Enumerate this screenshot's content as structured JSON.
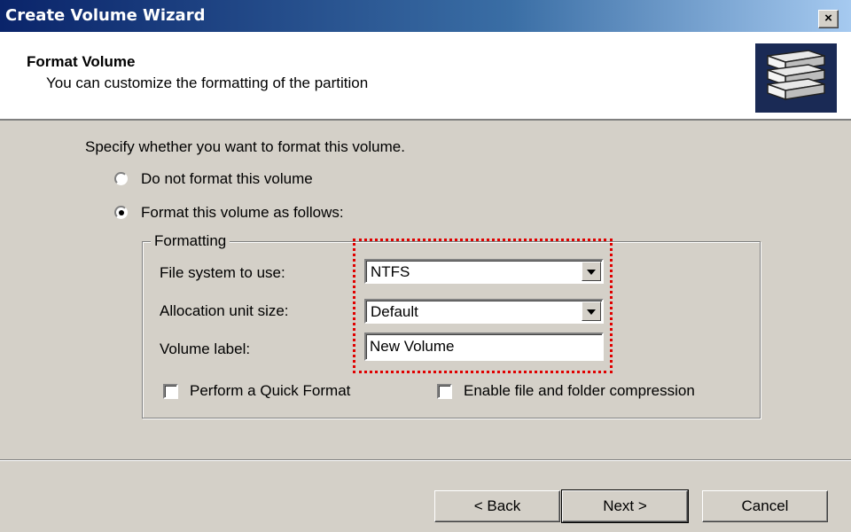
{
  "window": {
    "title": "Create Volume Wizard",
    "close_label": "×"
  },
  "header": {
    "title": "Format Volume",
    "subtitle": "You can customize the formatting of the partition"
  },
  "prompt": "Specify whether you want to format this volume.",
  "options": {
    "no_format": "Do not format this volume",
    "format": "Format this volume as follows:",
    "selected": "format"
  },
  "formatting": {
    "legend": "Formatting",
    "file_system_label": "File system to use:",
    "file_system_value": "NTFS",
    "allocation_label": "Allocation unit size:",
    "allocation_value": "Default",
    "volume_label_label": "Volume label:",
    "volume_label_value": "New Volume",
    "quick_format_label": "Perform a Quick Format",
    "compression_label": "Enable file and folder compression"
  },
  "buttons": {
    "back": "< Back",
    "next": "Next >",
    "cancel": "Cancel"
  },
  "colors": {
    "titlebar_start": "#0a246a",
    "dialog_bg": "#d4d0c8",
    "highlight": "#e00000"
  }
}
